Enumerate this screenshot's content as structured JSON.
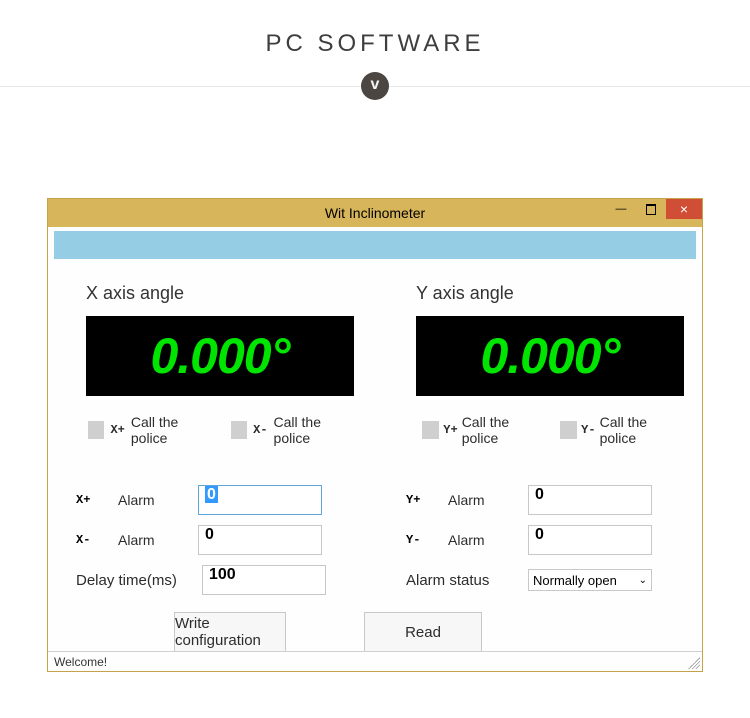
{
  "page": {
    "title": "PC  SOFTWARE",
    "badge": "v"
  },
  "window": {
    "title": "Wit Inclinometer",
    "min_glyph": "—",
    "close_glyph": "×"
  },
  "x": {
    "heading": "X axis angle",
    "value": "0.000°",
    "chk1_prefix": "X+",
    "chk1_label": "Call the police",
    "chk2_prefix": "X-",
    "chk2_label": "Call the police",
    "r1_k1": "X+",
    "r1_k2": "Alarm",
    "r1_val": "0",
    "r2_k1": "X-",
    "r2_k2": "Alarm",
    "r2_val": "0",
    "r3_k": "Delay time(ms)",
    "r3_val": "100"
  },
  "y": {
    "heading": "Y axis angle",
    "value": "0.000°",
    "chk1_prefix": "Y+",
    "chk1_label": "Call the police",
    "chk2_prefix": "Y-",
    "chk2_label": "Call the police",
    "r1_k1": "Y+",
    "r1_k2": "Alarm",
    "r1_val": "0",
    "r2_k1": "Y-",
    "r2_k2": "Alarm",
    "r2_val": "0",
    "r3_k": "Alarm status",
    "r3_val": "Normally open"
  },
  "buttons": {
    "write": "Write configuration",
    "read": "Read"
  },
  "status": "Welcome!"
}
